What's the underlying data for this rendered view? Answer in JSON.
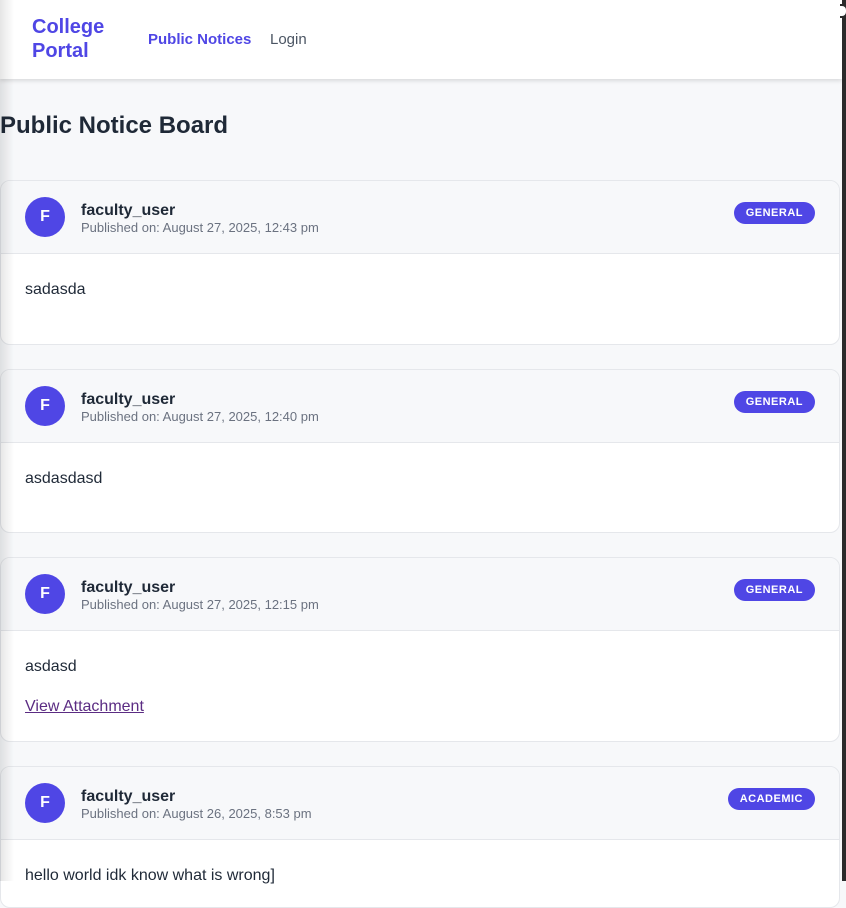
{
  "header": {
    "logo": "College Portal",
    "nav": [
      {
        "label": "Public Notices",
        "active": true
      },
      {
        "label": "Login",
        "active": false
      }
    ]
  },
  "page": {
    "title": "Public Notice Board"
  },
  "notices": [
    {
      "avatar_letter": "F",
      "author": "faculty_user",
      "published": "Published on: August 27, 2025, 12:43 pm",
      "category": "GENERAL",
      "body": "sadasda"
    },
    {
      "avatar_letter": "F",
      "author": "faculty_user",
      "published": "Published on: August 27, 2025, 12:40 pm",
      "category": "GENERAL",
      "body": "asdasdasd"
    },
    {
      "avatar_letter": "F",
      "author": "faculty_user",
      "published": "Published on: August 27, 2025, 12:15 pm",
      "category": "GENERAL",
      "body": "asdasd",
      "attachment_label": "View Attachment"
    },
    {
      "avatar_letter": "F",
      "author": "faculty_user",
      "published": "Published on: August 26, 2025, 8:53 pm",
      "category": "ACADEMIC",
      "body": "hello world idk know what is wrong]"
    }
  ],
  "colors": {
    "accent": "#4f46e5",
    "page_bg": "#f7f8fa",
    "link_visited": "#5b2c83"
  }
}
